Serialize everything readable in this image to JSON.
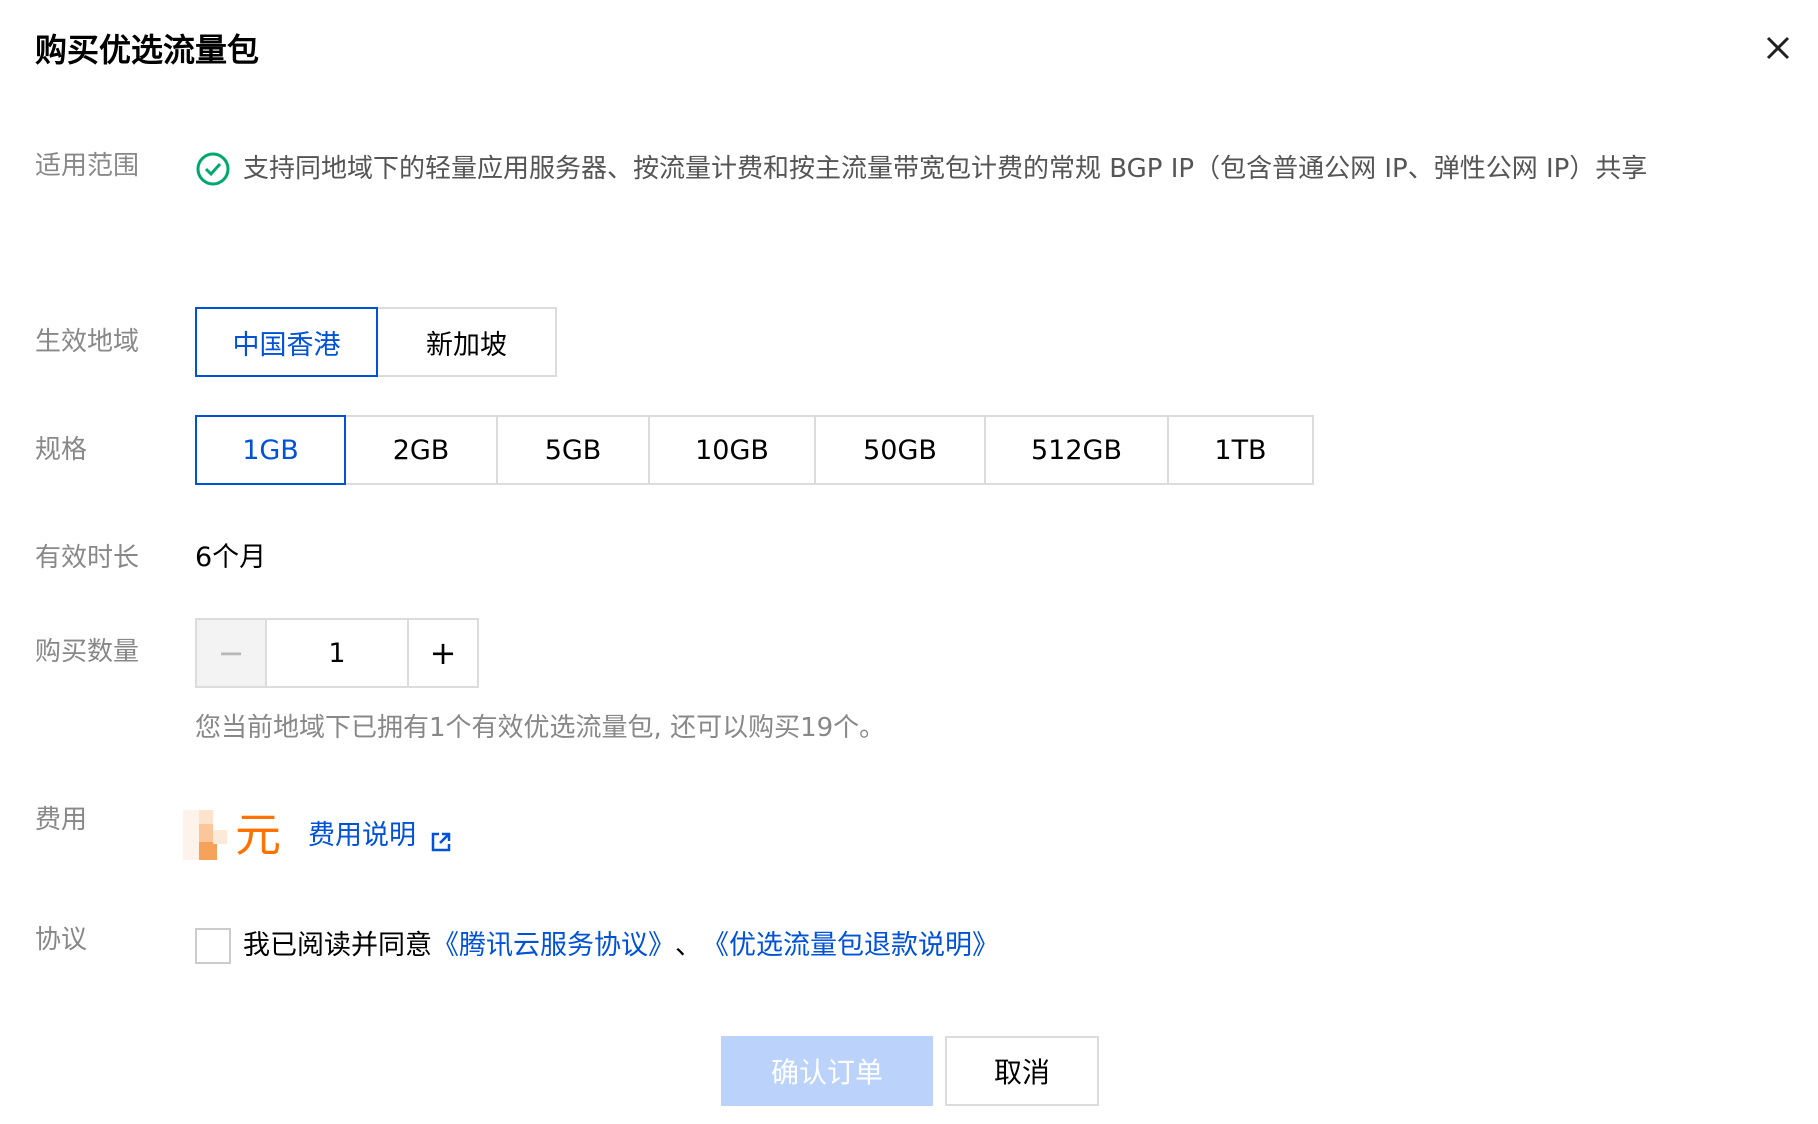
{
  "dialog": {
    "title": "购买优选流量包",
    "close_icon": "close-icon"
  },
  "scope": {
    "label": "适用范围",
    "icon": "check-circle-icon",
    "icon_color": "#00a870",
    "text": "支持同地域下的轻量应用服务器、按流量计费和按主流量带宽包计费的常规 BGP IP（包含普通公网 IP、弹性公网 IP）共享"
  },
  "region": {
    "label": "生效地域",
    "options": [
      {
        "label": "中国香港",
        "selected": true
      },
      {
        "label": "新加坡",
        "selected": false
      }
    ]
  },
  "spec": {
    "label": "规格",
    "options": [
      {
        "label": "1GB",
        "selected": true
      },
      {
        "label": "2GB",
        "selected": false
      },
      {
        "label": "5GB",
        "selected": false
      },
      {
        "label": "10GB",
        "selected": false
      },
      {
        "label": "50GB",
        "selected": false
      },
      {
        "label": "512GB",
        "selected": false
      },
      {
        "label": "1TB",
        "selected": false
      }
    ]
  },
  "duration": {
    "label": "有效时长",
    "value": "6个月"
  },
  "quantity": {
    "label": "购买数量",
    "minus": "−",
    "value": "1",
    "plus": "+",
    "hint": "您当前地域下已拥有1个有效优选流量包, 还可以购买19个。"
  },
  "fee": {
    "label": "费用",
    "unit": "元",
    "link_label": "费用说明",
    "link_icon": "external-link-icon",
    "price_color": "#ff7200"
  },
  "agreement": {
    "label": "协议",
    "checked": false,
    "prefix": "我已阅读并同意",
    "link1": "《腾讯云服务协议》",
    "separator": "、",
    "link2": "《优选流量包退款说明》"
  },
  "actions": {
    "confirm_label": "确认订单",
    "confirm_disabled": true,
    "cancel_label": "取消"
  },
  "colors": {
    "accent": "#0052d9",
    "confirm_disabled_bg": "#bbd3fb"
  }
}
